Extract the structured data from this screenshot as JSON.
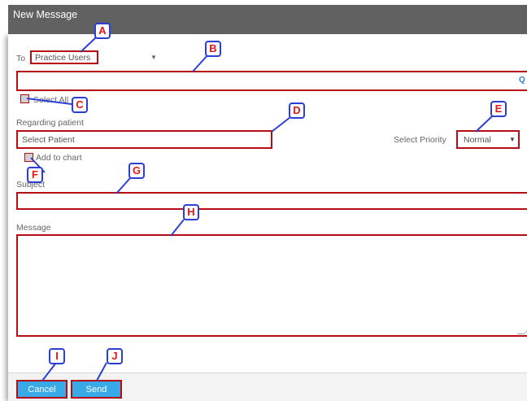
{
  "window": {
    "title": "New Message"
  },
  "to": {
    "label": "To",
    "selected": "Practice Users",
    "arrow": "▼"
  },
  "recipient_search": {
    "value": "",
    "icon": "search-icon",
    "glyph": "Q"
  },
  "select_all": {
    "label": "Select All",
    "checked": false
  },
  "regarding": {
    "label": "Regarding patient",
    "placeholder": "Select Patient"
  },
  "priority": {
    "label": "Select Priority",
    "selected": "Normal",
    "arrow": "▼"
  },
  "add_to_chart": {
    "label": "Add to chart",
    "checked": false
  },
  "subject": {
    "label": "Subject",
    "value": ""
  },
  "message": {
    "label": "Message",
    "value": ""
  },
  "footer": {
    "cancel_label": "Cancel",
    "send_label": "Send"
  },
  "callouts": [
    "A",
    "B",
    "C",
    "D",
    "E",
    "F",
    "G",
    "H",
    "I",
    "J"
  ],
  "colors": {
    "titlebar": "#616161",
    "highlight": "#b80c14",
    "button": "#3aa9e8",
    "callout_border": "#2b3fd6",
    "callout_text": "#e01818"
  }
}
